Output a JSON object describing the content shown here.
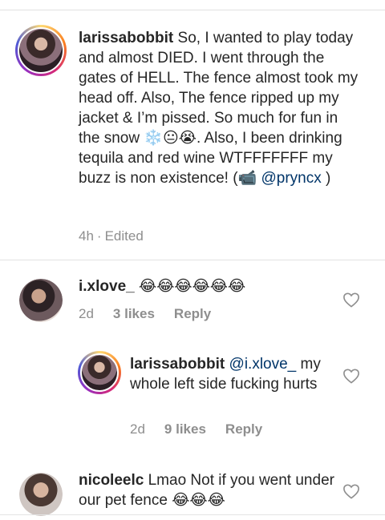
{
  "comments": [
    {
      "username": "larissabobbit",
      "text": "So, I wanted to play today and almost DIED. I went through the gates of HELL. The fence almost took my head off. Also, The fence ripped up my jacket & I’m pissed. So much for fun in the snow ❄️😐😭. Also,  I been drinking tequila and red wine WTFFFFFFF my buzz is non existence! (📹",
      "mention": "@pryncx",
      "text_end": ")",
      "time": "4h",
      "dot": "·",
      "edited": "Edited"
    },
    {
      "username": "i.xlove_",
      "text": "😂😂😂😂😂😂",
      "time": "2d",
      "likes": "3 likes",
      "reply": "Reply"
    },
    {
      "username": "larissabobbit",
      "mention": "@i.xlove_",
      "text": "my whole left side fucking hurts",
      "time": "2d",
      "likes": "9 likes",
      "reply": "Reply"
    },
    {
      "username": "nicoleelc",
      "text": "Lmao Not if you went under our pet fence 😂😂😂"
    }
  ],
  "icons": {
    "heart": "heart-outline-icon"
  },
  "colors": {
    "text": "#262626",
    "meta": "#8e8e8e",
    "mention": "#003569"
  }
}
